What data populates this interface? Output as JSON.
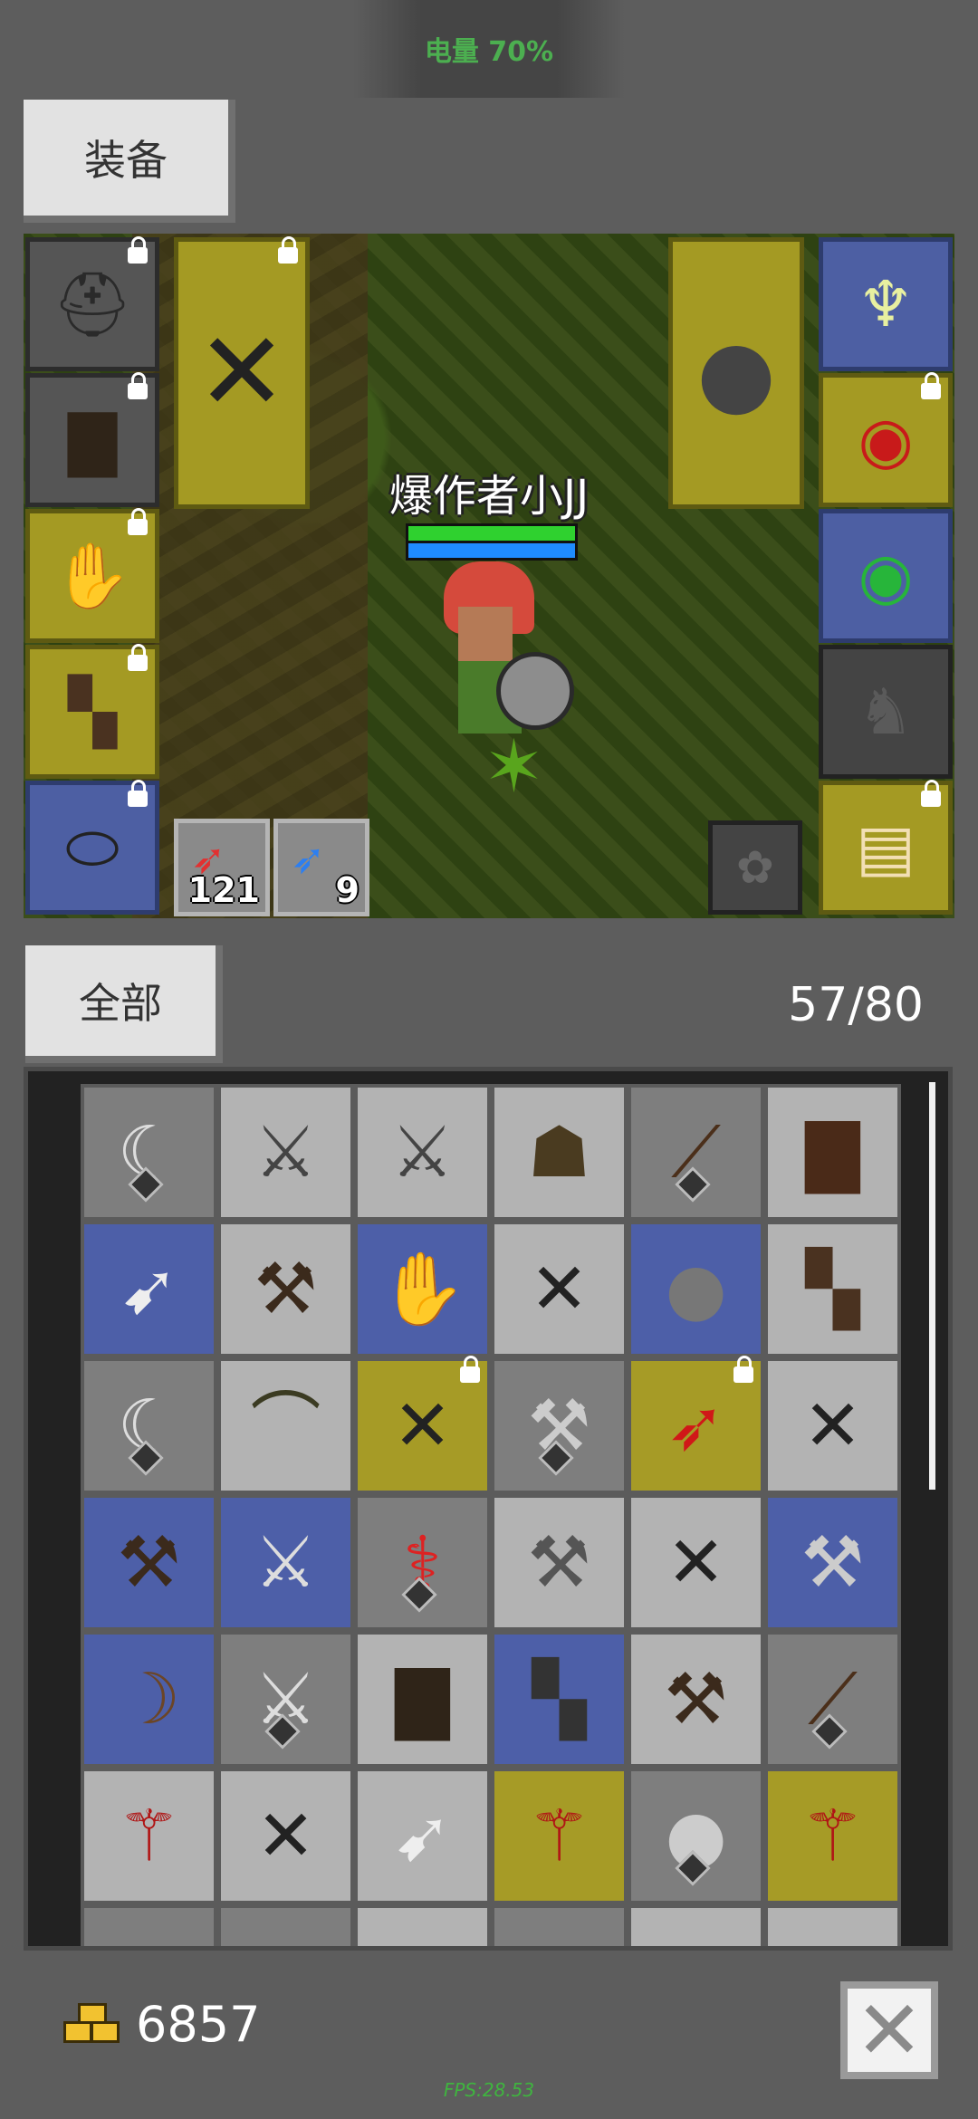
{
  "status": {
    "battery": "电量 70%"
  },
  "equip_button": "装备",
  "player": {
    "name": "爆作者小JJ"
  },
  "quick_slots": [
    {
      "icon": "red-feather-icon",
      "count": "121"
    },
    {
      "icon": "blue-feather-icon",
      "count": "9"
    }
  ],
  "filter_button": "全部",
  "inventory": {
    "count": "57/80"
  },
  "gold": {
    "amount": "6857"
  },
  "fps": "FPS:28.53",
  "colors": {
    "slot_yellow": "#a69b26",
    "slot_blue": "#4d5fa8",
    "slot_gray": "#7e7e7e",
    "slot_light": "#b3b3b3",
    "battery_text": "#4caf50"
  },
  "equipment": {
    "left": [
      "horned-helmet-icon",
      "dark-armor-icon",
      "leather-glove-icon",
      "leather-boots-icon",
      "belt-icon"
    ],
    "weapon_main": "crossed-spears-icon",
    "weapon_off": "round-shield-icon",
    "right": [
      "horned-amulet-icon",
      "ruby-ring-icon",
      "emerald-ring-icon",
      "empty-mount-slot-icon",
      "spell-scroll-icon"
    ],
    "bottom_right": "empty-skill-slot-icon"
  },
  "inventory_items": [
    [
      "scythe-icon",
      "short-sword-icon",
      "short-sword-icon",
      "hood-icon",
      "club-icon",
      "leather-armor-icon"
    ],
    [
      "quill-dart-icon",
      "spiked-mace-icon",
      "leather-glove-icon",
      "crossed-spears-icon",
      "round-shield-icon",
      "leather-boots-icon"
    ],
    [
      "scythe-icon",
      "leather-cap-icon",
      "crossed-spears-icon",
      "axe-icon",
      "red-feather-icon",
      "crossed-spears-icon"
    ],
    [
      "spiked-mace-icon",
      "short-sword-icon",
      "ruby-staff-icon",
      "axe-icon",
      "crossed-spears-icon",
      "axe-icon"
    ],
    [
      "bow-icon",
      "short-sword-icon",
      "dark-armor-icon",
      "iron-boots-icon",
      "spiked-mace-icon",
      "club-icon"
    ],
    [
      "red-halberd-icon",
      "crossed-spears-icon",
      "quill-dart-icon",
      "red-halberd-icon",
      "round-shield-icon",
      "red-halberd-icon"
    ]
  ]
}
